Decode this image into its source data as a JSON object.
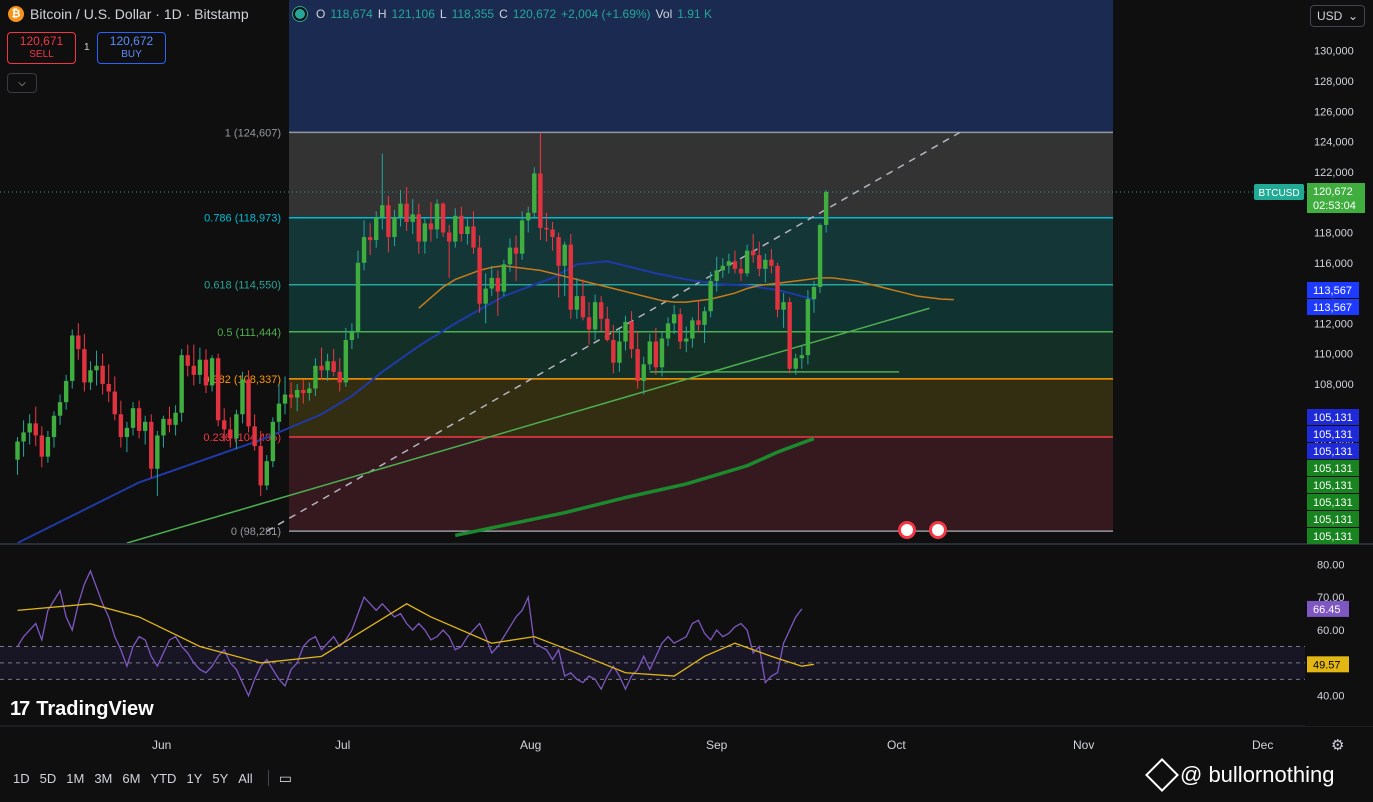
{
  "header": {
    "title": "Bitcoin / U.S. Dollar · 1D · Bitstamp",
    "logo": "₿",
    "ohlc": {
      "o_label": "O",
      "o": "118,674",
      "h_label": "H",
      "h": "121,106",
      "l_label": "L",
      "l": "118,355",
      "c_label": "C",
      "c": "120,672",
      "change": "+2,004 (+1.69%)",
      "vol_label": "Vol",
      "vol": "1.91 K"
    }
  },
  "trade": {
    "sell_price": "120,671",
    "sell_label": "SELL",
    "spread": "1",
    "buy_price": "120,672",
    "buy_label": "BUY"
  },
  "currency": "USD",
  "price_axis": {
    "ticks": [
      "130,000",
      "128,000",
      "126,000",
      "124,000",
      "122,000",
      "120,000",
      "118,000",
      "116,000",
      "114,000",
      "112,000",
      "110,000",
      "108,000",
      "106,000",
      "104,000"
    ],
    "symbol_tag": "BTCUSD",
    "last_price": "120,672",
    "countdown": "02:53:04",
    "ma_tags": [
      "113,567",
      "113,567"
    ],
    "blue_tags": [
      "105,131",
      "105,131",
      "105,131"
    ],
    "green_tags": [
      "105,131",
      "105,131",
      "105,131",
      "105,131",
      "105,131"
    ]
  },
  "fib_levels": [
    {
      "label": "1 (124,607)",
      "price": 124607,
      "color": "#9598a1"
    },
    {
      "label": "0.786 (118,973)",
      "price": 118973,
      "color": "#00bcd4"
    },
    {
      "label": "0.618 (114,550)",
      "price": 114550,
      "color": "#26a69a"
    },
    {
      "label": "0.5 (111,444)",
      "price": 111444,
      "color": "#4caf50"
    },
    {
      "label": "0.382 (108,337)",
      "price": 108337,
      "color": "#ff9800"
    },
    {
      "label": "0.236 (104,495)",
      "price": 104495,
      "color": "#f23645"
    },
    {
      "label": "0 (98,281)",
      "price": 98281,
      "color": "#9598a1"
    }
  ],
  "rsi_axis": {
    "ticks": [
      "80.00",
      "70.00",
      "60.00",
      "40.00"
    ],
    "rsi_value": "66.45",
    "ma_value": "49.57"
  },
  "time_axis": [
    "Jun",
    "Jul",
    "Aug",
    "Sep",
    "Oct",
    "Nov",
    "Dec"
  ],
  "ranges": [
    "1D",
    "5D",
    "1M",
    "3M",
    "6M",
    "YTD",
    "1Y",
    "5Y",
    "All"
  ],
  "brand": "TradingView",
  "watermark": "@ bullornothing",
  "colors": {
    "up": "#26a69a",
    "down": "#f23645",
    "bg": "#0f0f0f"
  },
  "chart_data": {
    "type": "candlestick",
    "title": "Bitcoin / U.S. Dollar · 1D · Bitstamp",
    "ylim": [
      97500,
      131500
    ],
    "x_start": "2025-05-13",
    "candles": [
      [
        103000,
        104500,
        102000,
        104200
      ],
      [
        104200,
        105600,
        103200,
        104800
      ],
      [
        104800,
        106000,
        104000,
        105400
      ],
      [
        105400,
        106500,
        103900,
        104600
      ],
      [
        104600,
        105200,
        102500,
        103200
      ],
      [
        103200,
        104900,
        102800,
        104500
      ],
      [
        104500,
        106200,
        103800,
        105900
      ],
      [
        105900,
        107300,
        105300,
        106800
      ],
      [
        106800,
        108600,
        106300,
        108200
      ],
      [
        108200,
        111600,
        107700,
        111200
      ],
      [
        111200,
        112000,
        109600,
        110300
      ],
      [
        110300,
        111300,
        107500,
        108100
      ],
      [
        108100,
        109500,
        107600,
        108900
      ],
      [
        108900,
        110200,
        107900,
        109200
      ],
      [
        109200,
        110000,
        107300,
        108000
      ],
      [
        108000,
        109300,
        106800,
        107500
      ],
      [
        107500,
        108500,
        105600,
        106000
      ],
      [
        106000,
        106900,
        103800,
        104500
      ],
      [
        104500,
        105500,
        103500,
        105100
      ],
      [
        105100,
        106800,
        104600,
        106400
      ],
      [
        106400,
        106900,
        104400,
        104900
      ],
      [
        104900,
        105900,
        104000,
        105500
      ],
      [
        105500,
        106000,
        101800,
        102400
      ],
      [
        102400,
        104900,
        100600,
        104600
      ],
      [
        104600,
        105900,
        103800,
        105700
      ],
      [
        105700,
        106500,
        104800,
        105300
      ],
      [
        105300,
        106600,
        104600,
        106100
      ],
      [
        106100,
        110300,
        105500,
        109900
      ],
      [
        109900,
        110600,
        108500,
        109200
      ],
      [
        109200,
        110600,
        107900,
        108600
      ],
      [
        108600,
        110400,
        108000,
        109600
      ],
      [
        109600,
        110300,
        107400,
        107900
      ],
      [
        107900,
        109900,
        107500,
        109700
      ],
      [
        109700,
        110000,
        105200,
        105600
      ],
      [
        105600,
        106400,
        104200,
        105000
      ],
      [
        105000,
        105800,
        103800,
        104400
      ],
      [
        104400,
        106300,
        103700,
        106000
      ],
      [
        106000,
        108800,
        105400,
        108300
      ],
      [
        108300,
        108900,
        104800,
        105200
      ],
      [
        105200,
        106000,
        103600,
        103900
      ],
      [
        103900,
        104900,
        100600,
        101300
      ],
      [
        101300,
        103300,
        101000,
        102900
      ],
      [
        102900,
        105800,
        102500,
        105500
      ],
      [
        105500,
        108000,
        104900,
        106700
      ],
      [
        106700,
        108500,
        106000,
        107300
      ],
      [
        107300,
        108100,
        106400,
        107100
      ],
      [
        107100,
        108000,
        106200,
        107600
      ],
      [
        107600,
        108300,
        106700,
        107400
      ],
      [
        107400,
        108100,
        106900,
        107700
      ],
      [
        107700,
        109700,
        107200,
        109200
      ],
      [
        109200,
        110400,
        108300,
        108900
      ],
      [
        108900,
        110000,
        108200,
        109500
      ],
      [
        109500,
        110300,
        108500,
        108800
      ],
      [
        108800,
        109700,
        107500,
        108100
      ],
      [
        108100,
        111700,
        107800,
        110900
      ],
      [
        110900,
        112000,
        110300,
        111400
      ],
      [
        111400,
        116800,
        111000,
        116000
      ],
      [
        116000,
        118800,
        115500,
        117700
      ],
      [
        117700,
        118600,
        116500,
        117500
      ],
      [
        117500,
        119400,
        117000,
        119000
      ],
      [
        119000,
        123200,
        118200,
        119800
      ],
      [
        119800,
        120400,
        116700,
        117700
      ],
      [
        117700,
        119500,
        117100,
        119000
      ],
      [
        119000,
        120800,
        118400,
        119900
      ],
      [
        119900,
        121000,
        118100,
        118700
      ],
      [
        118700,
        120200,
        117900,
        119200
      ],
      [
        119200,
        119900,
        116600,
        117400
      ],
      [
        117400,
        118900,
        116600,
        118600
      ],
      [
        118600,
        120000,
        117400,
        118200
      ],
      [
        118200,
        120200,
        117600,
        119900
      ],
      [
        119900,
        120000,
        117700,
        118000
      ],
      [
        118000,
        118500,
        115000,
        117400
      ],
      [
        117400,
        119600,
        117000,
        119100
      ],
      [
        119100,
        119700,
        117400,
        117900
      ],
      [
        117900,
        118900,
        117200,
        118400
      ],
      [
        118400,
        119400,
        116600,
        117000
      ],
      [
        117000,
        117800,
        112700,
        113300
      ],
      [
        113300,
        115300,
        112000,
        114300
      ],
      [
        114300,
        115800,
        113800,
        115000
      ],
      [
        115000,
        115500,
        112500,
        114100
      ],
      [
        114100,
        116200,
        113800,
        115900
      ],
      [
        115900,
        117600,
        115400,
        117000
      ],
      [
        117000,
        117800,
        114800,
        116600
      ],
      [
        116600,
        119400,
        116200,
        118800
      ],
      [
        118800,
        119700,
        118000,
        119300
      ],
      [
        119300,
        122300,
        118900,
        121900
      ],
      [
        121900,
        124600,
        117500,
        118300
      ],
      [
        118300,
        119300,
        117400,
        118200
      ],
      [
        118200,
        118700,
        116800,
        117700
      ],
      [
        117700,
        118000,
        113700,
        115800
      ],
      [
        115800,
        117400,
        113800,
        117200
      ],
      [
        117200,
        117900,
        112300,
        112900
      ],
      [
        112900,
        115000,
        112300,
        113800
      ],
      [
        113800,
        114900,
        112200,
        112400
      ],
      [
        112400,
        113400,
        110600,
        111600
      ],
      [
        111600,
        113900,
        110900,
        113400
      ],
      [
        113400,
        113800,
        111500,
        112300
      ],
      [
        112300,
        113100,
        110800,
        110900
      ],
      [
        110900,
        111900,
        108700,
        109400
      ],
      [
        109400,
        111600,
        108800,
        110800
      ],
      [
        110800,
        112500,
        110200,
        112100
      ],
      [
        112100,
        112800,
        109700,
        110300
      ],
      [
        110300,
        111500,
        107700,
        108200
      ],
      [
        108200,
        109800,
        107300,
        109300
      ],
      [
        109300,
        111300,
        108900,
        110800
      ],
      [
        110800,
        111700,
        108600,
        109100
      ],
      [
        109100,
        111400,
        108500,
        111000
      ],
      [
        111000,
        112400,
        110500,
        112000
      ],
      [
        112000,
        113200,
        111300,
        112600
      ],
      [
        112600,
        113000,
        110300,
        110800
      ],
      [
        110800,
        111800,
        110100,
        111000
      ],
      [
        111000,
        112400,
        110400,
        112200
      ],
      [
        112200,
        113500,
        111400,
        111900
      ],
      [
        111900,
        113100,
        110700,
        112800
      ],
      [
        112800,
        115400,
        112400,
        114800
      ],
      [
        114800,
        116400,
        114100,
        115500
      ],
      [
        115500,
        116300,
        115000,
        115800
      ],
      [
        115800,
        116600,
        115300,
        116100
      ],
      [
        116100,
        116800,
        115300,
        115600
      ],
      [
        115600,
        116200,
        114800,
        115300
      ],
      [
        115300,
        117200,
        115100,
        116800
      ],
      [
        116800,
        117900,
        116000,
        116500
      ],
      [
        116500,
        117400,
        115100,
        115600
      ],
      [
        115600,
        116600,
        114700,
        116200
      ],
      [
        116200,
        116900,
        115300,
        115800
      ],
      [
        115800,
        116000,
        112400,
        112900
      ],
      [
        112900,
        114000,
        111700,
        113400
      ],
      [
        113400,
        113700,
        108700,
        109000
      ],
      [
        109000,
        110000,
        108600,
        109700
      ],
      [
        109700,
        110500,
        109000,
        109900
      ],
      [
        109900,
        114200,
        109300,
        113600
      ],
      [
        113600,
        114800,
        112700,
        114400
      ],
      [
        114400,
        118600,
        114000,
        118500
      ],
      [
        118500,
        120800,
        118000,
        120672
      ]
    ],
    "ma_50_orange": {
      "from_index": 66,
      "values": [
        113000,
        113700,
        114400,
        114900,
        115200,
        115500,
        115700,
        115800,
        115700,
        115600,
        115500,
        115300,
        115100,
        114900,
        114700,
        114500,
        114300,
        114100,
        113900,
        113700,
        113500,
        113400,
        113400,
        113500,
        113600,
        113800,
        114000,
        114300,
        114500,
        114600,
        114700,
        114800,
        114900,
        115000,
        115000,
        114900,
        114800,
        114600,
        114400,
        114200,
        114000,
        113800,
        113700,
        113600,
        113567
      ]
    },
    "ma_blue": {
      "from_index": 0,
      "values_sparse": [
        [
          0,
          96500
        ],
        [
          20,
          101500
        ],
        [
          40,
          104300
        ],
        [
          50,
          106000
        ],
        [
          55,
          107200
        ],
        [
          60,
          108800
        ],
        [
          66,
          110500
        ],
        [
          72,
          112000
        ],
        [
          80,
          113800
        ],
        [
          88,
          115000
        ],
        [
          92,
          115900
        ],
        [
          97,
          116100
        ],
        [
          100,
          115800
        ],
        [
          105,
          115300
        ],
        [
          110,
          114900
        ],
        [
          115,
          114600
        ],
        [
          120,
          114500
        ],
        [
          125,
          114200
        ],
        [
          128,
          113900
        ],
        [
          131,
          113567
        ]
      ]
    },
    "ma_200_green": {
      "values_sparse": [
        [
          72,
          98000
        ],
        [
          90,
          99500
        ],
        [
          100,
          100500
        ],
        [
          110,
          101400
        ],
        [
          120,
          102600
        ],
        [
          125,
          103500
        ],
        [
          131,
          104400
        ]
      ]
    },
    "trendline_dashed": {
      "start": [
        41,
        98281
      ],
      "end": [
        155,
        124607
      ]
    },
    "trendline_green": {
      "start": [
        18,
        97500
      ],
      "end": [
        150,
        113000
      ]
    },
    "support_line": {
      "start": [
        104,
        108800
      ],
      "end": [
        145,
        108800
      ]
    },
    "rsi": {
      "ylim": [
        32,
        85
      ],
      "bands": [
        30,
        50,
        70
      ],
      "values": [
        55,
        58,
        60,
        62,
        57,
        66,
        69,
        72,
        64,
        60,
        68,
        74,
        78,
        73,
        68,
        64,
        58,
        54,
        49,
        55,
        58,
        57,
        52,
        49,
        53,
        57,
        58,
        55,
        53,
        50,
        48,
        47,
        49,
        52,
        54,
        50,
        48,
        44,
        40,
        45,
        49,
        51,
        48,
        45,
        43,
        48,
        50,
        55,
        57,
        58,
        54,
        56,
        58,
        55,
        57,
        60,
        65,
        70,
        68,
        66,
        68,
        66,
        64,
        65,
        62,
        60,
        62,
        60,
        57,
        58,
        60,
        58,
        54,
        55,
        58,
        60,
        62,
        58,
        53,
        55,
        58,
        61,
        64,
        66,
        70,
        56,
        55,
        54,
        51,
        54,
        46,
        47,
        45,
        44,
        46,
        45,
        42,
        46,
        49,
        46,
        42,
        46,
        48,
        52,
        48,
        52,
        56,
        58,
        56,
        57,
        58,
        62,
        63,
        59,
        57,
        60,
        58,
        59,
        61,
        62,
        60,
        53,
        55,
        44,
        46,
        47,
        56,
        60,
        64,
        66.45
      ]
    },
    "rsi_ma": {
      "values_sparse": [
        [
          0,
          66
        ],
        [
          12,
          68
        ],
        [
          20,
          64
        ],
        [
          30,
          55
        ],
        [
          40,
          50
        ],
        [
          50,
          52
        ],
        [
          57,
          60
        ],
        [
          64,
          68
        ],
        [
          68,
          64
        ],
        [
          78,
          56
        ],
        [
          85,
          58
        ],
        [
          92,
          53
        ],
        [
          100,
          47
        ],
        [
          108,
          46
        ],
        [
          113,
          52
        ],
        [
          118,
          56
        ],
        [
          124,
          52
        ],
        [
          129,
          49
        ],
        [
          131,
          49.57
        ]
      ]
    }
  }
}
